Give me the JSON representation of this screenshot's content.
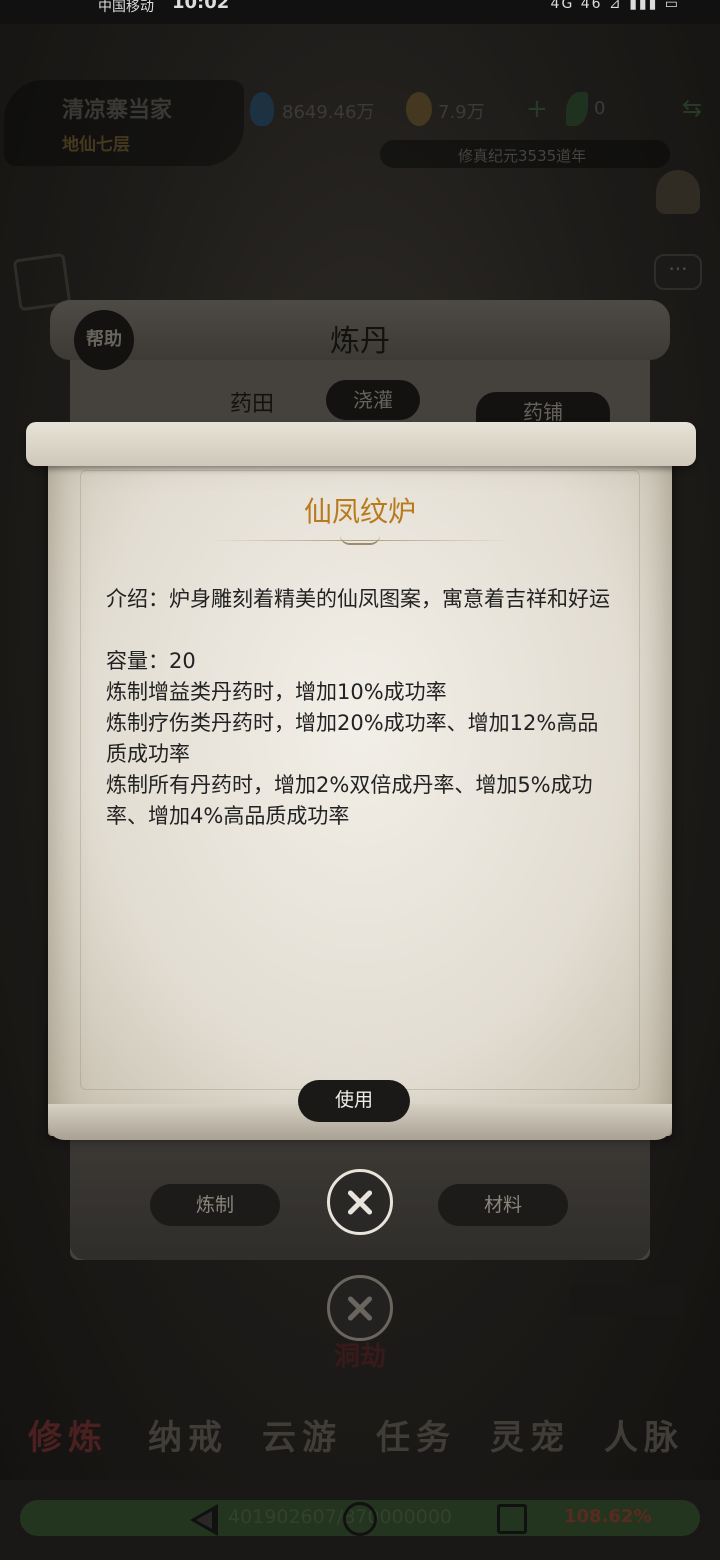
{
  "status_bar": {
    "carrier": "中国移动",
    "time": "10:02",
    "right": "4G  46  ⊿  ▮▮▮  ▭"
  },
  "header": {
    "player_name": "清凉寨当家",
    "player_realm": "地仙七层",
    "spirit_stones": "8649.46万",
    "coins": "7.9万",
    "herbs": "0",
    "era": "修真纪元3535道年"
  },
  "back_panel": {
    "title": "炼丹",
    "help_label": "帮助",
    "tabs": [
      "药田",
      "浇灌",
      "药铺"
    ],
    "bottom_buttons": [
      "炼制",
      "材料"
    ],
    "under_label": "洞劫"
  },
  "item_detail": {
    "name": "仙凤纹炉",
    "intro": "介绍：炉身雕刻着精美的仙凤图案，寓意着吉祥和好运",
    "capacity": "容量：20",
    "effects": [
      "炼制增益类丹药时，增加10%成功率",
      "炼制疗伤类丹药时，增加20%成功率、增加12%高品质成功率",
      "炼制所有丹药时，增加2%双倍成丹率、增加5%成功率、增加4%高品质成功率"
    ],
    "use_label": "使用"
  },
  "bottom_nav": [
    "修炼",
    "纳戒",
    "云游",
    "任务",
    "灵宠",
    "人脉"
  ],
  "progress": {
    "text": "401902607/870000000",
    "percent_label": "108.62%",
    "fraction": 1.0
  },
  "colors": {
    "title": "#b87a1c",
    "paper": "#e8e4da",
    "ink": "#1a1918"
  }
}
